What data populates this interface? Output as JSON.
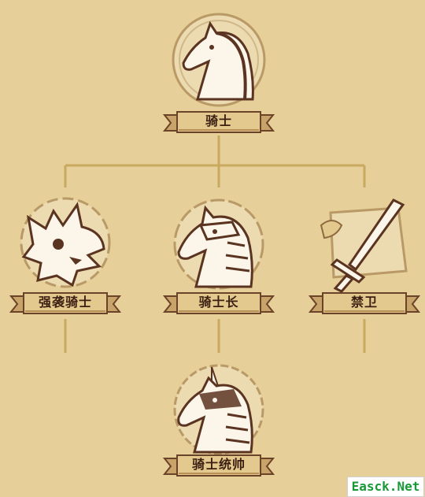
{
  "colors": {
    "background": "#e6cf98",
    "connector": "#c9a960",
    "banner": "#e3c98d",
    "banner_edge": "#6b4328",
    "label": "#3b1f12",
    "emblem_dark": "#5a3420",
    "emblem_light": "#fbf5ea",
    "watermark_text": "#169a35"
  },
  "tree": {
    "root": {
      "label": "骑士",
      "icon": "horse-head-icon"
    },
    "tier2": [
      {
        "label": "强袭骑士",
        "icon": "dragon-skull-icon"
      },
      {
        "label": "骑士长",
        "icon": "armored-horse-icon"
      },
      {
        "label": "禁卫",
        "icon": "sword-shield-icon"
      }
    ],
    "tier3": {
      "label": "骑士统帅",
      "icon": "armored-unicorn-icon"
    }
  },
  "watermark": "Easck.Net"
}
